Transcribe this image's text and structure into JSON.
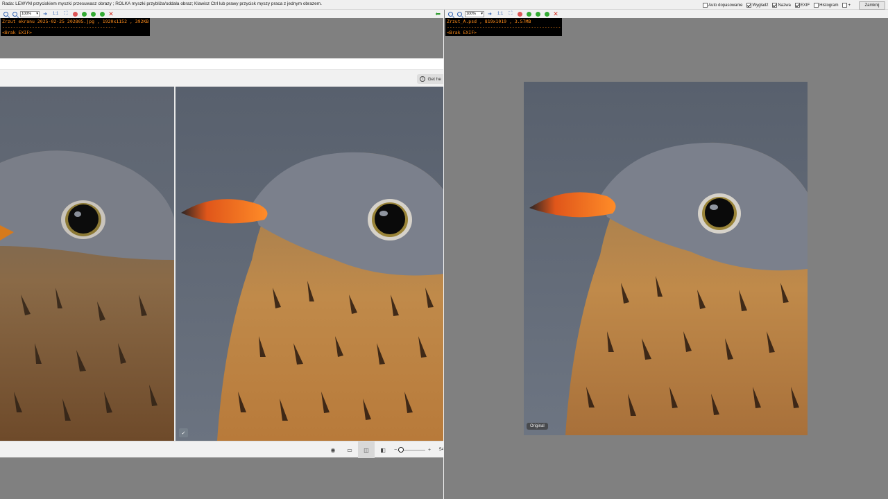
{
  "hint_text": "Rada: LEWYM przyciskiem myszki przesuwasz obrazy ; ROLKA myszki przybliża/oddala obraz; Klawisz Ctrl lub prawy przycisk myszy praca z jednym obrazem.",
  "options": [
    {
      "label": "Auto dopasowanie",
      "checked": false
    },
    {
      "label": "Wygładź",
      "checked": true
    },
    {
      "label": "Nazwa",
      "checked": true
    },
    {
      "label": "EXIF",
      "checked": true
    },
    {
      "label": "Histogram",
      "checked": false
    }
  ],
  "plus_label": "+",
  "close_label": "Zamknij",
  "left": {
    "zoom": "100%",
    "one_to_one": "1:1",
    "file_info": "Zrzut ekranu 2025-02-25 202805.jpg , 1920x1152 , 392KB",
    "separator": "------------------------------------------",
    "exif": "<Brak EXIF>",
    "get_help": "Get he",
    "zoom_percent": "54"
  },
  "right": {
    "zoom": "100%",
    "one_to_one": "1:1",
    "file_info": "Zrzut_A.psd , 819x1019 , 3.57MB",
    "separator": "------------------------------------------",
    "exif": "<Brak EXIF>",
    "original_badge": "Original"
  },
  "colors": {
    "info_text": "#ff8c1a",
    "back_arrow": "#2c9a2c",
    "close_x": "#d42a1a",
    "bird_beak": "#f06a16",
    "sky": "#5c6573"
  }
}
